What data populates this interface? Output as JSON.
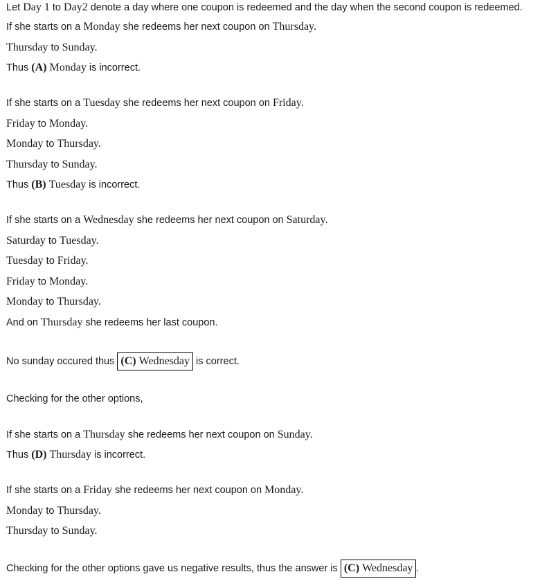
{
  "lines": [
    {
      "p1": "Let ",
      "m1": "Day",
      "p2": " ",
      "m2": "1",
      "p3": " to ",
      "m3": "Day2",
      "p4": " denote a day where one coupon is redeemed and the day when the second coupon is redeemed."
    },
    {
      "p1": "If she starts on a ",
      "m1": "Monday",
      "p2": " she redeems her next coupon on ",
      "m2": "Thursday."
    },
    {
      "m1": "Thursday",
      "p1": " to ",
      "m2": "Sunday."
    },
    {
      "p1": "Thus ",
      "b1": "(A)",
      "p2": " ",
      "m1": "Monday",
      "p3": " is incorrect."
    },
    {
      "p1": "If she starts on a ",
      "m1": "Tuesday",
      "p2": " she redeems her next coupon on ",
      "m2": "Friday."
    },
    {
      "m1": "Friday",
      "p1": " to ",
      "m2": "Monday."
    },
    {
      "m1": "Monday",
      "p1": " to ",
      "m2": "Thursday."
    },
    {
      "m1": "Thursday",
      "p1": " to ",
      "m2": "Sunday."
    },
    {
      "p1": "Thus ",
      "b1": "(B)",
      "p2": " ",
      "m1": "Tuesday",
      "p3": " is incorrect."
    },
    {
      "p1": "If she starts on a ",
      "m1": "Wednesday",
      "p2": " she redeems her next coupon on ",
      "m2": "Saturday."
    },
    {
      "m1": "Saturday",
      "p1": " to ",
      "m2": "Tuesday."
    },
    {
      "m1": "Tuesday",
      "p1": " to ",
      "m2": "Friday."
    },
    {
      "m1": "Friday",
      "p1": " to ",
      "m2": "Monday."
    },
    {
      "m1": "Monday",
      "p1": " to ",
      "m2": "Thursday."
    },
    {
      "p1": "And on ",
      "m1": "Thursday",
      "p2": " she redeems her last coupon."
    },
    {
      "p1": "No sunday occured thus ",
      "b1": "(C)",
      "m1": "Wednesday",
      "p2": " is correct."
    },
    {
      "p1": "Checking for the other options,"
    },
    {
      "p1": "If she starts on a ",
      "m1": "Thursday",
      "p2": " she redeems her next coupon on ",
      "m2": "Sunday."
    },
    {
      "p1": "Thus ",
      "b1": "(D)",
      "p2": " ",
      "m1": "Thursday",
      "p3": " is incorrect."
    },
    {
      "p1": "If she starts on a ",
      "m1": "Friday",
      "p2": " she redeems her next coupon on ",
      "m2": "Monday."
    },
    {
      "m1": "Monday",
      "p1": " to ",
      "m2": "Thursday."
    },
    {
      "m1": "Thursday",
      "p1": " to ",
      "m2": "Sunday."
    },
    {
      "p1": "Checking for the other options gave us negative results, thus the answer is ",
      "b1": "(C)",
      "m1": "Wednesday",
      "p2": "."
    }
  ]
}
